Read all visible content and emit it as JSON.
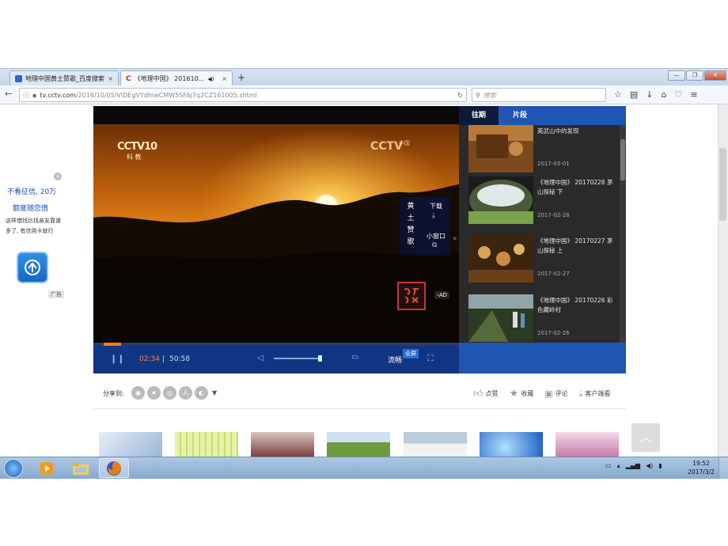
{
  "browser": {
    "tabs": [
      {
        "title": "地理中国黄土赞歌_百度搜索",
        "close": "×"
      },
      {
        "title": "《地理中国》 201610...",
        "close": "×"
      }
    ],
    "new_tab": "+",
    "url_host": "tv.cctv.com",
    "url_path": "/2016/10/05/VIDEgVYdhiwCMW5SFAj7q2CZ161005.shtml",
    "search_placeholder": "搜索"
  },
  "left_ad": {
    "close": "×",
    "line1": "不看征信, 20万",
    "line2": "额度随您借",
    "line3": "这样借钱比找亲友靠谱多了, 有信用卡就行",
    "label": "广告"
  },
  "player": {
    "channel_logo": "CCTV10",
    "channel_sub": "科 教",
    "watermark": "CCTV",
    "watermark_sub": "中国",
    "episode_title": "黄土赞歌",
    "download_label": "下载",
    "mini_window_label": "小窗口",
    "ad_badge": "AD",
    "progress_fraction": 0.046,
    "current_time": "02:34",
    "separator": "|",
    "duration": "50:58",
    "quality_label": "流畅",
    "fullscreen_tip": "全屏"
  },
  "playlist": {
    "tabs": [
      "往期",
      "片段"
    ],
    "items": [
      {
        "title": "英武山中的发现",
        "date": "2017-03-01"
      },
      {
        "title": "《地理中国》 20170228 茅山探秘 下",
        "date": "2017-02-28"
      },
      {
        "title": "《地理中国》 20170227 茅山探秘 上",
        "date": "2017-02-27"
      },
      {
        "title": "《地理中国》 20170226 彩色藏岭村",
        "date": "2017-02-26"
      }
    ]
  },
  "share": {
    "label": "分享到:",
    "actions": [
      {
        "icon": "thumbs-up-icon",
        "label": "点赞"
      },
      {
        "icon": "star-icon",
        "label": "收藏"
      },
      {
        "icon": "comment-icon",
        "label": "评论"
      },
      {
        "icon": "download-client-icon",
        "label": "客户端看"
      }
    ]
  },
  "taskbar": {
    "time": "19:52",
    "date": "2017/3/2"
  },
  "colors": {
    "player_blue": "#123583",
    "playlist_blue": "#1f56b3",
    "progress_orange": "#ff7a1a"
  }
}
